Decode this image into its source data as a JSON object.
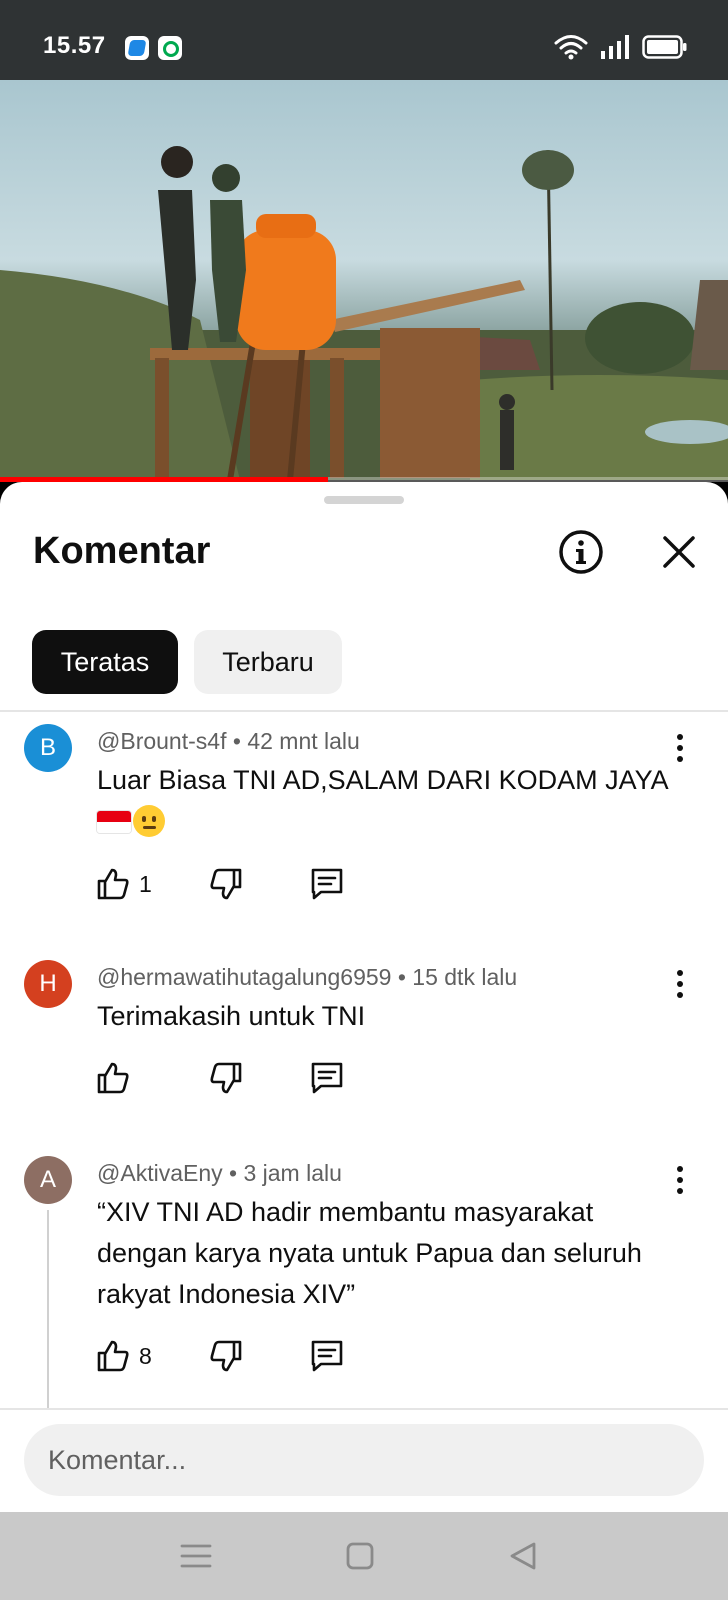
{
  "status_bar": {
    "time": "15.57",
    "icons": [
      "app-notification-icon",
      "app-notification-icon",
      "wifi-icon",
      "signal-icon",
      "battery-icon"
    ]
  },
  "video": {
    "progress_fraction": 0.45,
    "progress_color": "#ff0000"
  },
  "comments_panel": {
    "title": "Komentar",
    "tabs": [
      {
        "label": "Teratas",
        "active": true
      },
      {
        "label": "Terbaru",
        "active": false
      }
    ],
    "comments": [
      {
        "avatar_letter": "B",
        "avatar_color": "#1a8fd6",
        "author": "@Brount-s4f",
        "time": "42 mnt lalu",
        "text": "Luar Biasa TNI AD,SALAM DARI KODAM JAYA",
        "emojis": [
          "indonesia-flag-emoji",
          "slightly-smiling-face-emoji"
        ],
        "likes": "1"
      },
      {
        "avatar_letter": "H",
        "avatar_color": "#d4401f",
        "author": "@hermawatihutagalung6959",
        "time": "15 dtk lalu",
        "text": "Terimakasih untuk TNI",
        "likes": ""
      },
      {
        "avatar_letter": "A",
        "avatar_color": "#8d6e63",
        "author": "@AktivaEny",
        "time": "3 jam lalu",
        "text": "“XIV TNI AD hadir membantu masyarakat dengan karya nyata untuk Papua dan seluruh rakyat Indonesia XIV”",
        "likes": "8"
      }
    ],
    "input_placeholder": "Komentar..."
  },
  "nav_bar": {
    "buttons": [
      "menu-icon",
      "home-square-icon",
      "back-triangle-icon"
    ]
  }
}
